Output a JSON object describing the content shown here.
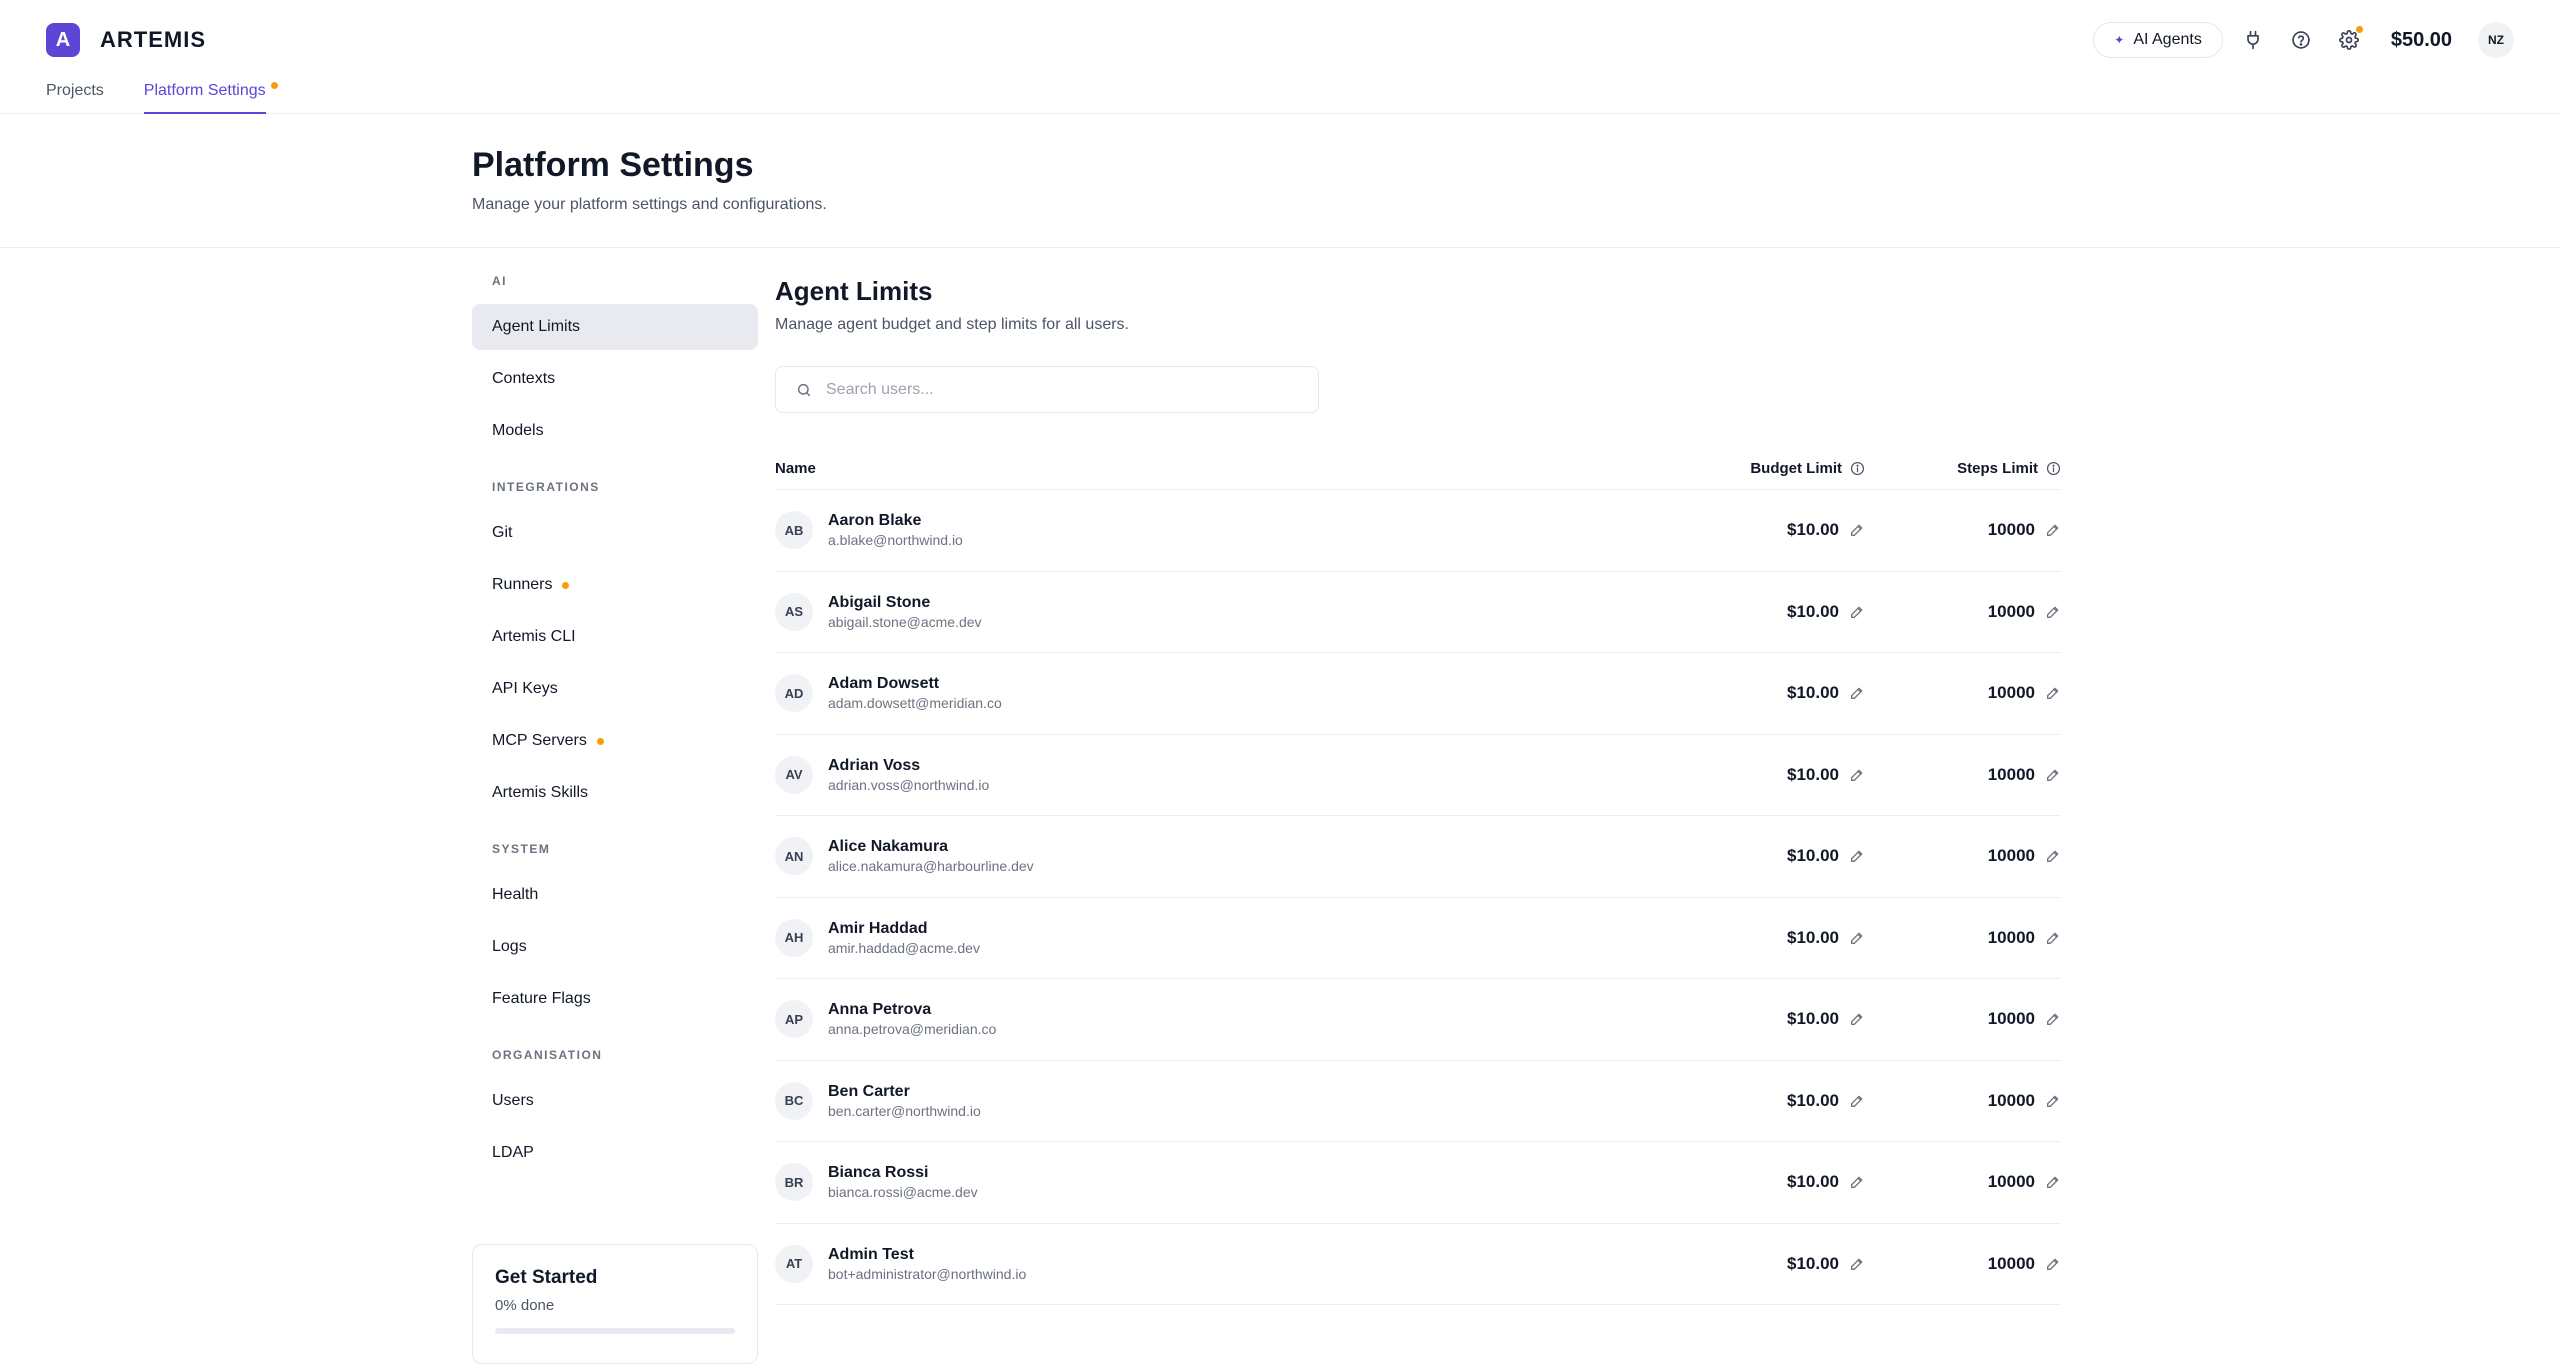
{
  "app": {
    "logo_letter": "A",
    "name": "ARTEMIS"
  },
  "top_tabs": [
    {
      "label": "Projects",
      "active": false
    },
    {
      "label": "Platform Settings",
      "active": true,
      "indicator": true
    }
  ],
  "top_right": {
    "ai_agents_label": "AI Agents",
    "balance": "$50.00",
    "user_initials": "NZ"
  },
  "header": {
    "title": "Platform Settings",
    "subtitle": "Manage your platform settings and configurations."
  },
  "sidebar": {
    "sections": [
      {
        "label": "AI",
        "items": [
          {
            "label": "Agent Limits",
            "active": true
          },
          {
            "label": "Contexts"
          },
          {
            "label": "Models"
          }
        ]
      },
      {
        "label": "INTEGRATIONS",
        "items": [
          {
            "label": "Git"
          },
          {
            "label": "Runners",
            "indicator": true
          },
          {
            "label": "Artemis CLI"
          },
          {
            "label": "API Keys"
          },
          {
            "label": "MCP Servers",
            "indicator": true
          },
          {
            "label": "Artemis Skills"
          }
        ]
      },
      {
        "label": "SYSTEM",
        "items": [
          {
            "label": "Health"
          },
          {
            "label": "Logs"
          },
          {
            "label": "Feature Flags"
          }
        ]
      },
      {
        "label": "ORGANISATION",
        "items": [
          {
            "label": "Users"
          },
          {
            "label": "LDAP"
          }
        ]
      }
    ]
  },
  "get_started": {
    "title": "Get Started",
    "progress_label": "0% done",
    "progress": 0
  },
  "main": {
    "title": "Agent Limits",
    "subtitle": "Manage agent budget and step limits for all users.",
    "search_placeholder": "Search users...",
    "columns": {
      "name": "Name",
      "budget": "Budget Limit",
      "steps": "Steps Limit"
    },
    "users": [
      {
        "initials": "AB",
        "name": "Aaron Blake",
        "email": "a.blake@northwind.io",
        "budget": "$10.00",
        "steps": "10000"
      },
      {
        "initials": "AS",
        "name": "Abigail Stone",
        "email": "abigail.stone@acme.dev",
        "budget": "$10.00",
        "steps": "10000"
      },
      {
        "initials": "AD",
        "name": "Adam Dowsett",
        "email": "adam.dowsett@meridian.co",
        "budget": "$10.00",
        "steps": "10000"
      },
      {
        "initials": "AV",
        "name": "Adrian Voss",
        "email": "adrian.voss@northwind.io",
        "budget": "$10.00",
        "steps": "10000"
      },
      {
        "initials": "AN",
        "name": "Alice Nakamura",
        "email": "alice.nakamura@harbourline.dev",
        "budget": "$10.00",
        "steps": "10000"
      },
      {
        "initials": "AH",
        "name": "Amir Haddad",
        "email": "amir.haddad@acme.dev",
        "budget": "$10.00",
        "steps": "10000"
      },
      {
        "initials": "AP",
        "name": "Anna Petrova",
        "email": "anna.petrova@meridian.co",
        "budget": "$10.00",
        "steps": "10000"
      },
      {
        "initials": "BC",
        "name": "Ben Carter",
        "email": "ben.carter@northwind.io",
        "budget": "$10.00",
        "steps": "10000"
      },
      {
        "initials": "BR",
        "name": "Bianca Rossi",
        "email": "bianca.rossi@acme.dev",
        "budget": "$10.00",
        "steps": "10000"
      },
      {
        "initials": "AT",
        "name": "Admin Test",
        "email": "bot+administrator@northwind.io",
        "budget": "$10.00",
        "steps": "10000"
      }
    ]
  },
  "colors": {
    "accent": "#5b46d6",
    "indicator": "#f59e0b",
    "active_bg": "#e9eaef"
  }
}
